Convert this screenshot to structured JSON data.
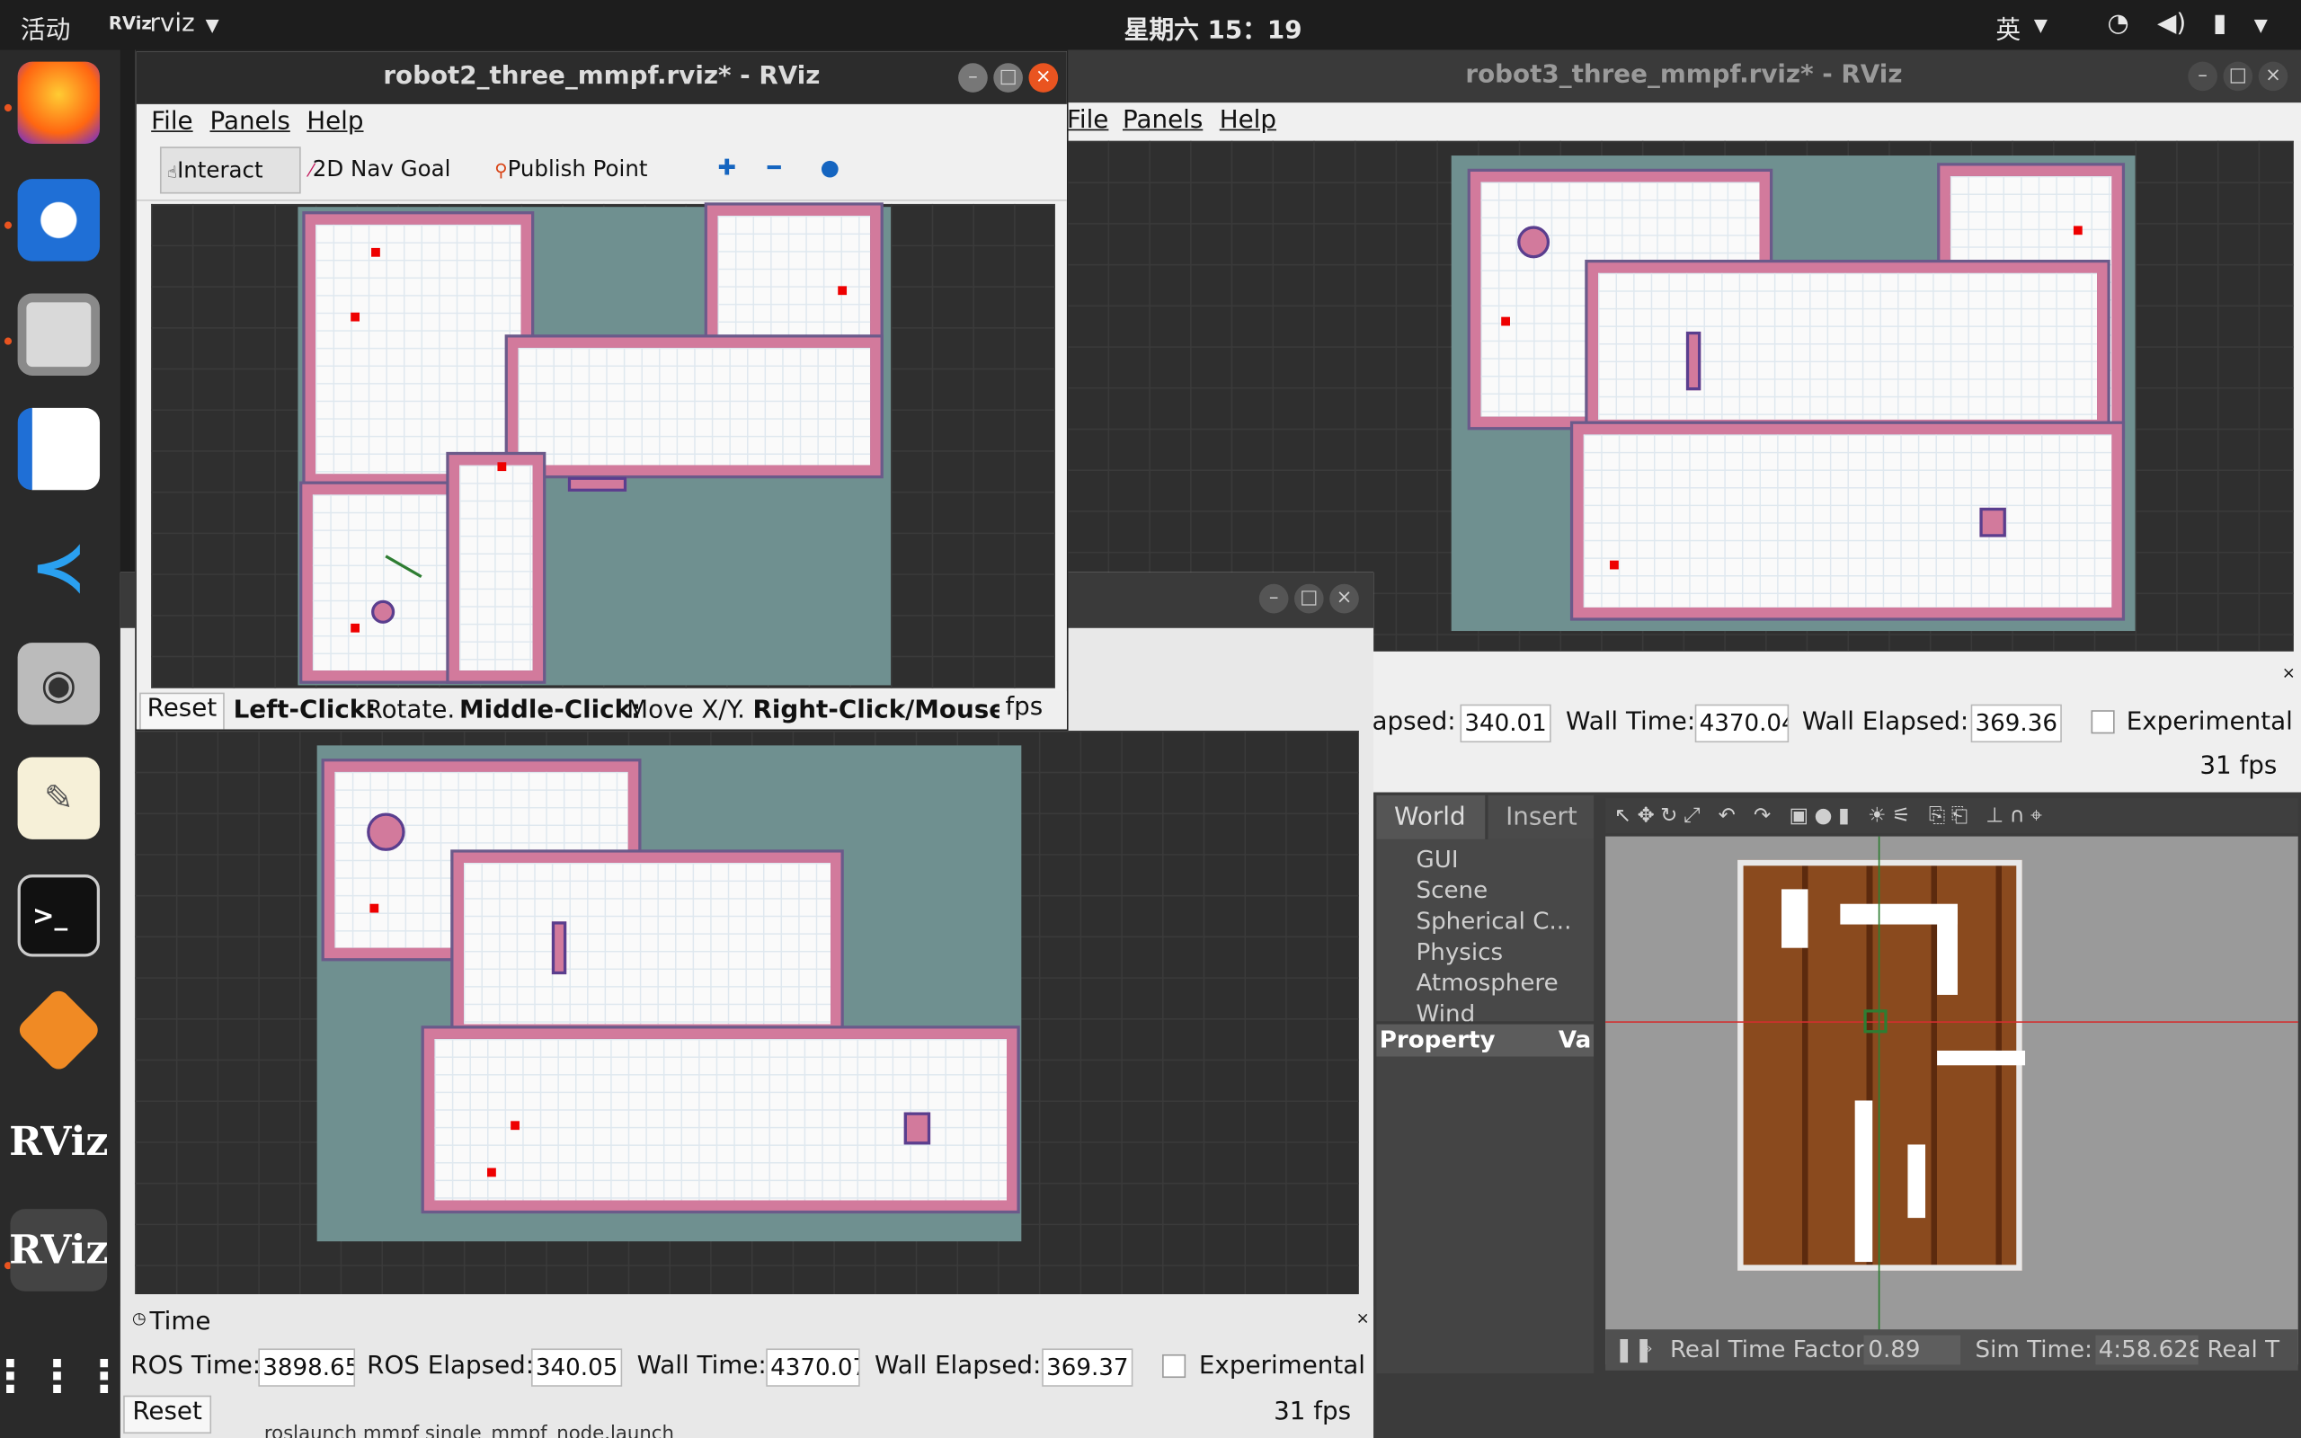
{
  "topbar": {
    "activities": "活动",
    "app": "rviz",
    "clock": "星期六 15：19",
    "lang": "英"
  },
  "dock": [
    "firefox-icon",
    "thunderbird-icon",
    "files-icon",
    "writer-icon",
    "vscode-icon",
    "camera-icon",
    "text-editor-icon",
    "terminal-icon",
    "software-icon",
    "RViz",
    "RViz",
    "apps-grid-icon"
  ],
  "win_robot2": {
    "title": "robot2_three_mmpf.rviz* - RViz",
    "menu": [
      "File",
      "Panels",
      "Help"
    ],
    "tools": {
      "interact": "Interact",
      "nav_goal": "2D Nav Goal",
      "publish_point": "Publish Point"
    },
    "status": {
      "reset": "Reset",
      "hint_b1": "Left-Click:",
      "hint_t1": " Rotate. ",
      "hint_b2": "Middle-Click:",
      "hint_t2": " Move X/Y. ",
      "hint_b3": "Right-Click/Mouse W",
      "fps": "fps"
    }
  },
  "win_robot3": {
    "title": "robot3_three_mmpf.rviz* - RViz",
    "menu": [
      "File",
      "Panels",
      "Help"
    ],
    "time": {
      "elapsed_label": "apsed:",
      "elapsed_val": "340.01",
      "wall_label": "Wall Time:",
      "wall_val": "4370.04",
      "wall_elapsed_label": "Wall Elapsed:",
      "wall_elapsed_val": "369.36",
      "experimental": "Experimental",
      "fps": "31 fps"
    }
  },
  "win_robot1": {
    "time_panel_title": "Time",
    "time": {
      "ros_time_label": "ROS Time:",
      "ros_time_val": "3898.65",
      "ros_elapsed_label": "ROS Elapsed:",
      "ros_elapsed_val": "340.05",
      "wall_label": "Wall Time:",
      "wall_val": "4370.07",
      "wall_elapsed_label": "Wall Elapsed:",
      "wall_elapsed_val": "369.37",
      "experimental": "Experimental",
      "reset": "Reset",
      "fps": "31 fps"
    },
    "terminal_fragment": "roslaunch mmpf single_mmpf_node.launch"
  },
  "gazebo": {
    "tabs": [
      "World",
      "Insert"
    ],
    "tree": [
      "GUI",
      "Scene",
      "Spherical C...",
      "Physics",
      "Atmosphere",
      "Wind"
    ],
    "property": "Property",
    "value": "Va",
    "bottom": {
      "rtf_label": "Real Time Factor:",
      "rtf_val": "0.89",
      "sim_label": "Sim Time:",
      "sim_val": "4:58.628",
      "real_label": "Real T"
    }
  },
  "colors": {
    "accent": "#e95420",
    "map_free": "#fafafa",
    "inflation": "#d27a9c",
    "unknown": "#6f9090"
  }
}
